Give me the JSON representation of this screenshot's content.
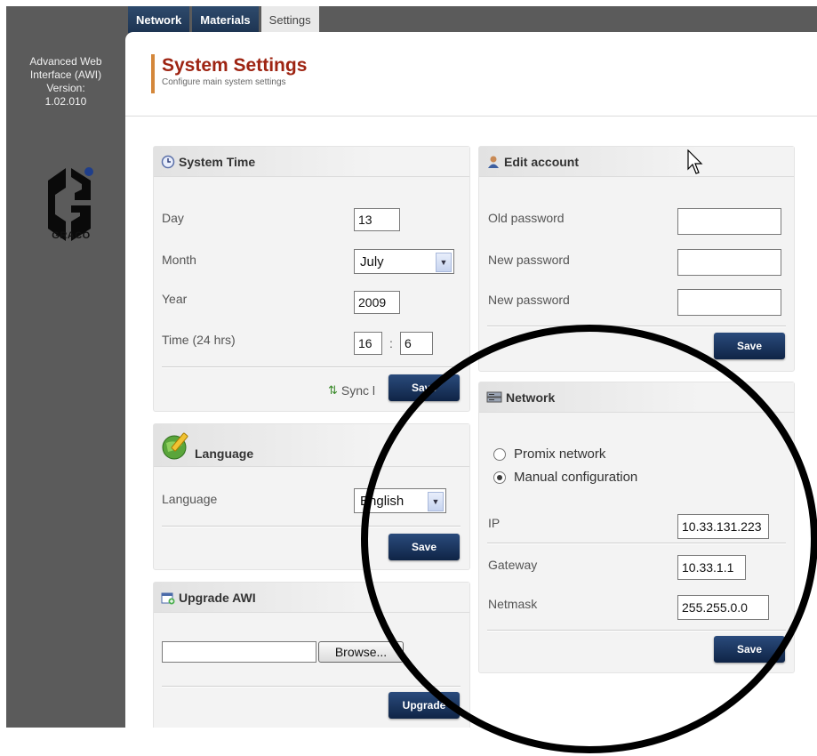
{
  "sidebar": {
    "app_name_line1": "Advanced Web",
    "app_name_line2": "Interface (AWI)",
    "version_label": "Version:",
    "version_value": "1.02.010",
    "logo_text": "GRACO"
  },
  "tabs": [
    {
      "label": "Network",
      "active": false
    },
    {
      "label": "Materials",
      "active": false
    },
    {
      "label": "Settings",
      "active": true
    }
  ],
  "page": {
    "title": "System Settings",
    "subtitle": "Configure main system settings"
  },
  "system_time": {
    "title": "System Time",
    "day_label": "Day",
    "day_value": "13",
    "month_label": "Month",
    "month_value": "July",
    "year_label": "Year",
    "year_value": "2009",
    "time_label": "Time (24 hrs)",
    "hour_value": "16",
    "time_separator": ":",
    "minute_value": "6",
    "sync_label": "Sync l",
    "save_label": "Save"
  },
  "language": {
    "title": "Language",
    "field_label": "Language",
    "selected": "English",
    "save_label": "Save"
  },
  "upgrade": {
    "title": "Upgrade AWI",
    "file_value": "",
    "browse_label": "Browse...",
    "upgrade_label": "Upgrade"
  },
  "account": {
    "title": "Edit account",
    "old_password_label": "Old password",
    "new_password_label": "New password",
    "confirm_password_label": "New password",
    "save_label": "Save"
  },
  "network": {
    "title": "Network",
    "option_promix": "Promix network",
    "option_manual": "Manual configuration",
    "selected_option": "Manual configuration",
    "ip_label": "IP",
    "ip_value": "10.33.131.223",
    "gateway_label": "Gateway",
    "gateway_value": "10.33.1.1",
    "netmask_label": "Netmask",
    "netmask_value": "255.255.0.0",
    "save_label": "Save"
  },
  "colors": {
    "accent_title": "#9e2412",
    "tab_bar": "#1d3452",
    "button": "#0f2446",
    "sidebar": "#5b5b5b"
  }
}
